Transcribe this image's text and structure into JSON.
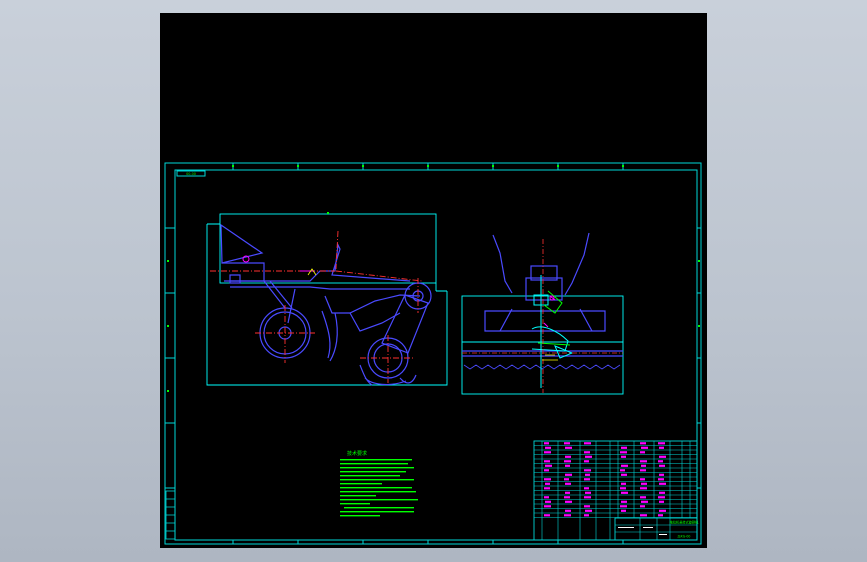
{
  "colors": {
    "background": "#000000",
    "frame": "#00d7d7",
    "outline": "#00ffff",
    "part": "#4a4aff",
    "centerline": "#ff3030",
    "annotation": "#00ff00",
    "highlight": "#ff00ff",
    "yellow": "#ffff00",
    "chrome": "#c4cbd6"
  },
  "drawing": {
    "title": "技术要求",
    "title_stamp": "拖拉机悬挂式旋耕机",
    "drawing_number": "JSXG-00",
    "sheet_tag": "00-00",
    "views": [
      "side-view",
      "rear-view"
    ]
  }
}
